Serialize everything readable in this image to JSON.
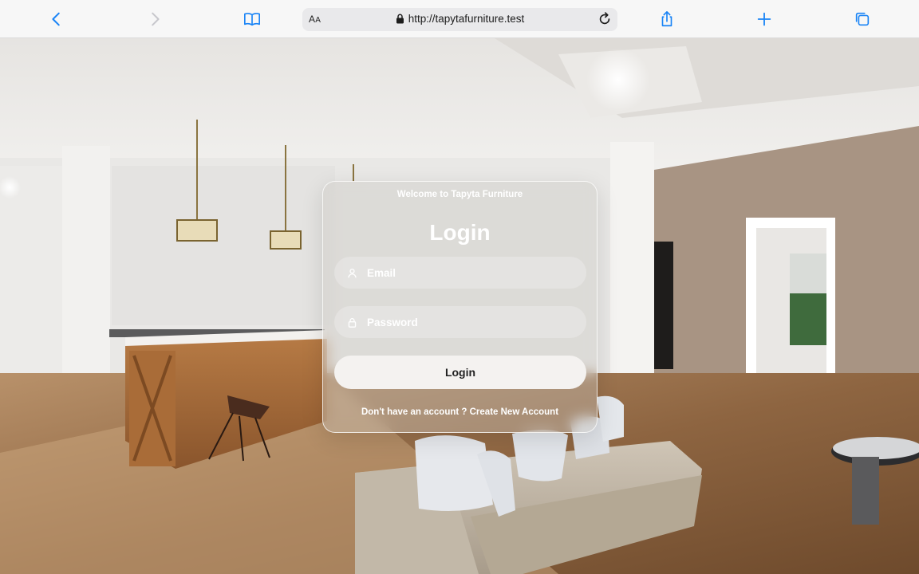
{
  "browser": {
    "aa_label_big": "A",
    "aa_label_small": "A",
    "url": "http://tapytafurniture.test"
  },
  "login": {
    "welcome": "Welcome to Tapyta Furniture",
    "title": "Login",
    "email_placeholder": "Email",
    "password_placeholder": "Password",
    "button_label": "Login",
    "no_account_text": "Don't have an account ?",
    "create_account_link": "Create New Account"
  },
  "colors": {
    "toolbar_icon": "#1a84f6",
    "toolbar_icon_disabled": "#c7c7cc"
  }
}
